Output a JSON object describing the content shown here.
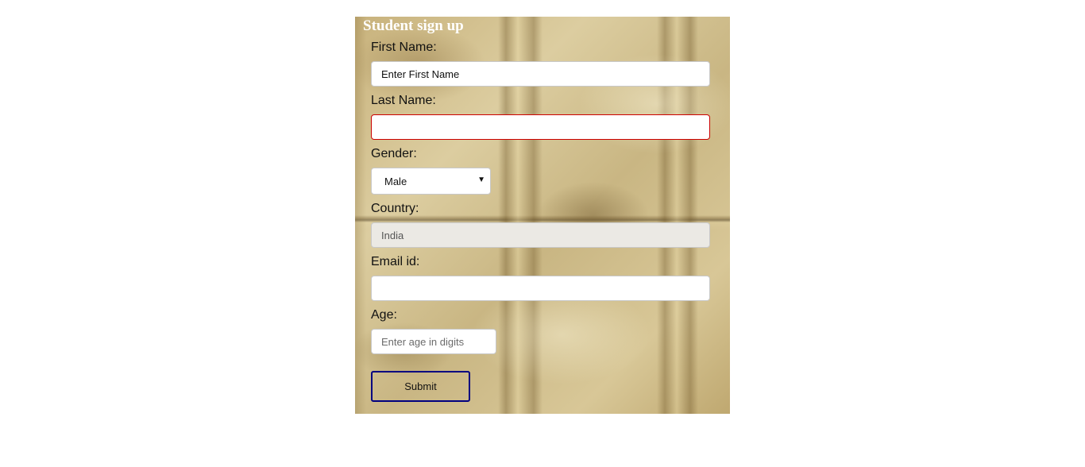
{
  "form": {
    "title": "Student sign up",
    "first_name": {
      "label": "First Name:",
      "placeholder": "Enter First Name",
      "value": ""
    },
    "last_name": {
      "label": "Last Name:",
      "placeholder": "",
      "value": "",
      "state": "invalid",
      "error_border_color": "#cc0000"
    },
    "gender": {
      "label": "Gender:",
      "selected": "Male"
    },
    "country": {
      "label": "Country:",
      "value": "India",
      "disabled": true
    },
    "email": {
      "label": "Email id:",
      "placeholder": "",
      "value": ""
    },
    "age": {
      "label": "Age:",
      "placeholder": "Enter age in digits",
      "value": ""
    },
    "submit_label": "Submit",
    "submit_border_color": "#000080"
  }
}
